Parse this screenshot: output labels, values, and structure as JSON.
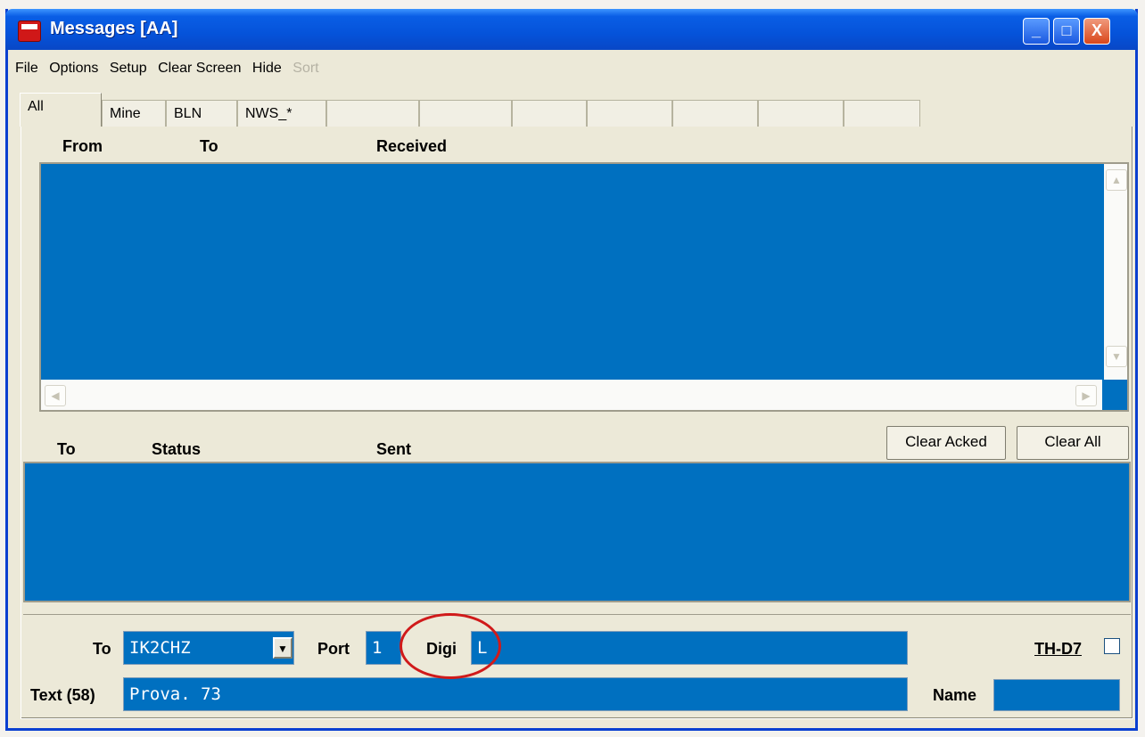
{
  "window": {
    "title": "Messages  [AA]",
    "minimize_label": "_",
    "maximize_label": "□",
    "close_label": "X"
  },
  "menubar": {
    "items": [
      {
        "label": "File"
      },
      {
        "label": "Options"
      },
      {
        "label": "Setup"
      },
      {
        "label": "Clear Screen"
      },
      {
        "label": "Hide"
      },
      {
        "label": "Sort",
        "disabled": true
      }
    ]
  },
  "tabs": [
    {
      "label": "All",
      "active": true
    },
    {
      "label": "Mine"
    },
    {
      "label": "BLN"
    },
    {
      "label": "NWS_*"
    },
    {
      "label": ""
    },
    {
      "label": ""
    },
    {
      "label": ""
    },
    {
      "label": ""
    },
    {
      "label": ""
    },
    {
      "label": ""
    },
    {
      "label": ""
    }
  ],
  "received_list": {
    "columns": [
      "From",
      "To",
      "Received"
    ]
  },
  "sent_list": {
    "columns": [
      "To",
      "Status",
      "Sent"
    ],
    "clear_acked_label": "Clear Acked",
    "clear_all_label": "Clear All"
  },
  "compose": {
    "to_label": "To",
    "to_value": "IK2CHZ",
    "port_label": "Port",
    "port_value": "1",
    "digi_label": "Digi",
    "digi_value": "L",
    "thd7_label": "TH-D7",
    "thd7_checked": false,
    "text_label": "Text (58)",
    "text_value": "Prova. 73",
    "name_label": "Name",
    "name_value": ""
  },
  "colors": {
    "list_background": "#0070c0",
    "annotation_circle": "#d01a1a",
    "titlebar": "#0553da"
  },
  "icons": {
    "app": "messages-app-icon",
    "combo": "chevron-down-icon",
    "scroll_up": "arrow-up-icon",
    "scroll_down": "arrow-down-icon",
    "scroll_left": "arrow-left-icon",
    "scroll_right": "arrow-right-icon"
  }
}
